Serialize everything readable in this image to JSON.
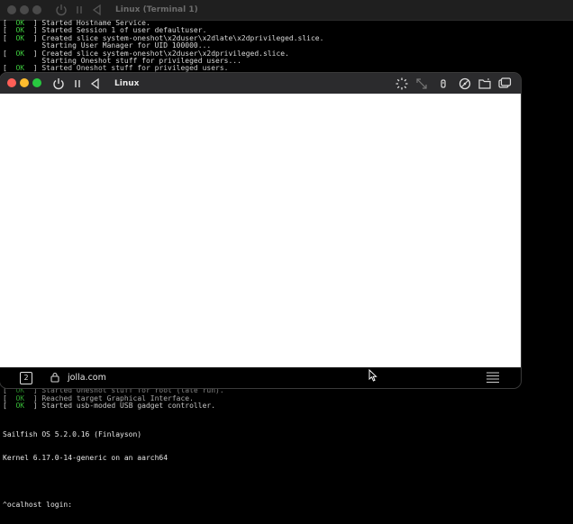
{
  "terminal": {
    "title": "Linux (Terminal 1)",
    "log_top": [
      {
        "status": "OK",
        "text": "Started Hostname Service."
      },
      {
        "status": "OK",
        "text": "Started Session 1 of user defaultuser."
      },
      {
        "status": "OK",
        "text": "Created slice system-oneshot\\x2duser\\x2dlate\\x2dprivileged.slice."
      },
      {
        "status": "",
        "text": "Starting User Manager for UID 100000..."
      },
      {
        "status": "OK",
        "text": "Created slice system-oneshot\\x2duser\\x2dprivileged.slice."
      },
      {
        "status": "",
        "text": "Starting Oneshot stuff for privileged users..."
      },
      {
        "status": "OK",
        "text": "Started Oneshot stuff for privileged users."
      }
    ],
    "log_bottom": [
      {
        "status": "OK",
        "text": "Started Oneshot stuff for root (late run)."
      },
      {
        "status": "OK",
        "text": "Reached target Graphical Interface."
      },
      {
        "status": "OK",
        "text": "Started usb-moded USB gadget controller."
      }
    ],
    "os_line": "Sailfish OS 5.2.0.16 (Finlayson)",
    "kernel_line": "Kernel 6.17.0-14-generic on an aarch64",
    "login_prompt": "^ocalhost login:"
  },
  "front_window": {
    "title": "Linux",
    "bottom_bar": {
      "tab_count": "2",
      "url": "jolla.com"
    }
  },
  "icons": {
    "power": "power-icon",
    "pause": "pause-icon",
    "back": "back-triangle-icon",
    "brightness": "brightness-icon",
    "fullscreen": "resize-arrows-icon",
    "usb": "usb-icon",
    "disc": "disc-icon",
    "folder": "shared-folder-icon",
    "windows": "windows-icon",
    "lock": "lock-icon",
    "menu": "menu-icon"
  }
}
